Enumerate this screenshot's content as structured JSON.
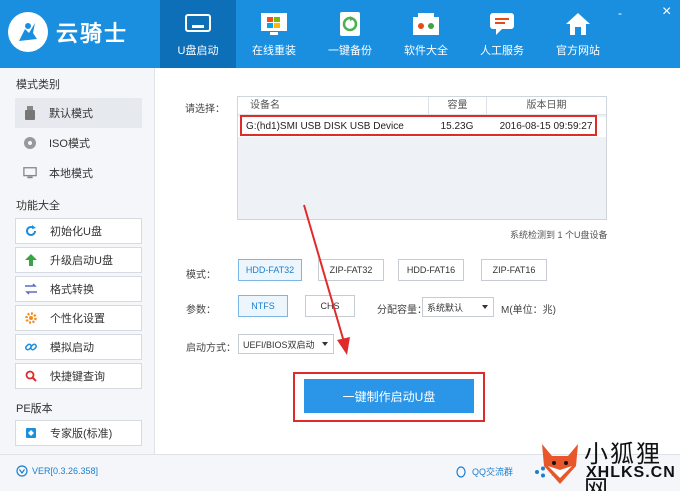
{
  "app": {
    "name": "云骑士"
  },
  "window": {
    "minimize": "-",
    "close": "×"
  },
  "nav": [
    {
      "label": "U盘启动",
      "icon": "usb-icon",
      "active": true
    },
    {
      "label": "在线重装",
      "icon": "windows-icon",
      "active": false
    },
    {
      "label": "一键备份",
      "icon": "backup-icon",
      "active": false
    },
    {
      "label": "软件大全",
      "icon": "software-icon",
      "active": false
    },
    {
      "label": "人工服务",
      "icon": "chat-icon",
      "active": false
    },
    {
      "label": "官方网站",
      "icon": "home-icon",
      "active": false
    }
  ],
  "sidebar": {
    "mode_title": "模式类别",
    "modes": [
      {
        "label": "默认模式",
        "icon": "usb-drive-icon"
      },
      {
        "label": "ISO模式",
        "icon": "disc-icon"
      },
      {
        "label": "本地模式",
        "icon": "monitor-icon"
      }
    ],
    "func_title": "功能大全",
    "funcs": [
      {
        "label": "初始化U盘",
        "icon": "refresh-icon"
      },
      {
        "label": "升级启动U盘",
        "icon": "arrow-up-icon"
      },
      {
        "label": "格式转换",
        "icon": "convert-icon"
      },
      {
        "label": "个性化设置",
        "icon": "gear-icon"
      },
      {
        "label": "模拟启动",
        "icon": "link-icon"
      },
      {
        "label": "快捷键查询",
        "icon": "search-icon"
      }
    ],
    "pe_title": "PE版本",
    "pe_item": {
      "label": "专家版(标准)",
      "icon": "shield-icon"
    }
  },
  "main": {
    "choose_label": "请选择：",
    "table": {
      "headers": [
        "设备名",
        "容量",
        "版本日期"
      ],
      "rows": [
        {
          "name": "G:(hd1)SMI USB DISK USB Device",
          "size": "15.23G",
          "date": "2016-08-15 09:59:27"
        }
      ]
    },
    "status": "系统检测到 1 个U盘设备",
    "mode_label": "模式：",
    "modes": [
      "HDD-FAT32",
      "ZIP-FAT32",
      "HDD-FAT16",
      "ZIP-FAT16"
    ],
    "param_label": "参数：",
    "params": [
      "NTFS",
      "CHS"
    ],
    "alloc_label": "分配容量：",
    "alloc_value": "系统默认",
    "unit_label": "M(单位：兆)",
    "boot_label": "启动方式：",
    "boot_value": "UEFI/BIOS双启动",
    "make_button": "一键制作启动U盘"
  },
  "footer": {
    "version": "VER[0.3.26.358]",
    "qq": "QQ交流群",
    "share": "分享"
  },
  "watermark": {
    "top": "小狐狸网",
    "bottom": "XHLKS.CN"
  },
  "colors": {
    "header": "#1a8fe0",
    "active_nav": "#0d6fb8",
    "highlight": "#e02b2b",
    "button": "#2b95e8"
  }
}
